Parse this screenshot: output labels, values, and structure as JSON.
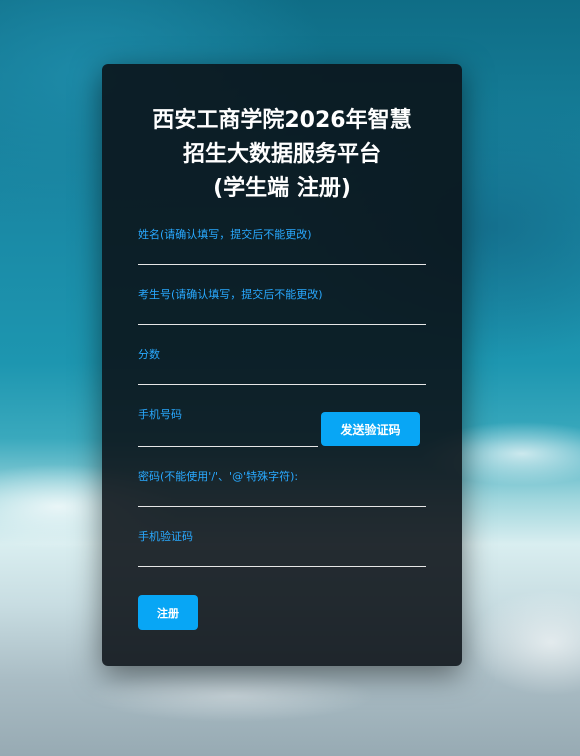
{
  "form": {
    "title_lines": [
      "西安工商学院2026年智慧",
      "招生大数据服务平台",
      "(学生端 注册)"
    ],
    "fields": {
      "name": {
        "label": "姓名(请确认填写，提交后不能更改)",
        "value": ""
      },
      "exam_number": {
        "label": "考生号(请确认填写，提交后不能更改)",
        "value": ""
      },
      "score": {
        "label": "分数",
        "value": ""
      },
      "phone": {
        "label": "手机号码",
        "value": ""
      },
      "password": {
        "label": "密码(不能使用'/'、'@'特殊字符):",
        "value": ""
      },
      "sms_code": {
        "label": "手机验证码",
        "value": ""
      }
    },
    "send_code_label": "发送验证码",
    "register_label": "注册"
  },
  "colors": {
    "accent": "#08a6f5",
    "label": "#29a9ff",
    "card_bg": "#0a1016"
  }
}
